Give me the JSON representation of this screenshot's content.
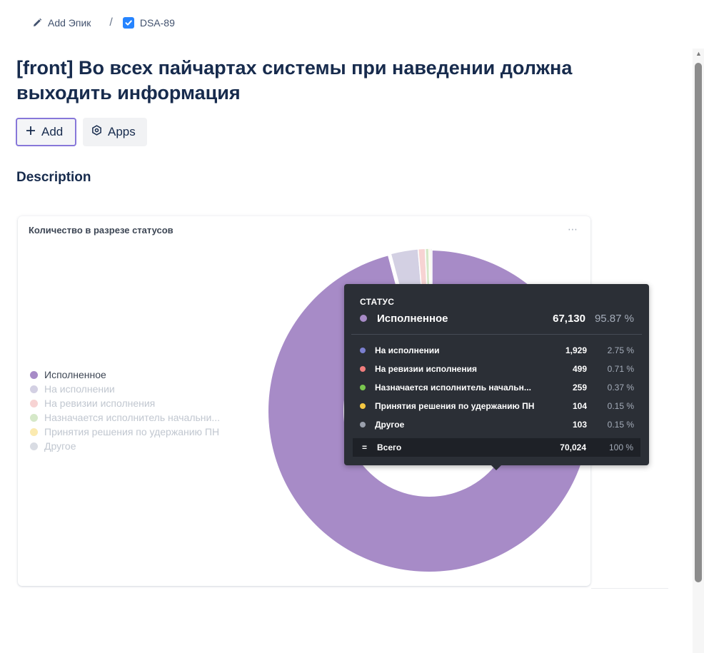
{
  "breadcrumb": {
    "parent_label": "Add Эпик",
    "separator": "/",
    "issue_key": "DSA-89"
  },
  "page_title": "[front] Во всех пайчартах системы при наведении должна выходить информация",
  "actions": {
    "add_label": "Add",
    "apps_label": "Apps"
  },
  "description_heading": "Description",
  "chart_data": {
    "type": "pie",
    "title": "Количество в разрезе статусов",
    "legend_position": "left",
    "categories": [
      "Исполненное",
      "На исполнении",
      "На ревизии исполнения",
      "Назначается исполнитель начальни...",
      "Принятия решения по удержанию ПН",
      "Другое"
    ],
    "values": [
      67130,
      1929,
      499,
      259,
      104,
      103
    ],
    "colors": [
      "#a78bc7",
      "#d3d0e3",
      "#f7d3d3",
      "#d5e8c8",
      "#fbeab0",
      "#d9dce3"
    ]
  },
  "tooltip": {
    "header": "СТАТУС",
    "main": {
      "name": "Исполненное",
      "value": "67,130",
      "pct": "95.87 %",
      "color": "#a78bc7"
    },
    "rows": [
      {
        "name": "На исполнении",
        "value": "1,929",
        "pct": "2.75 %",
        "color": "#7b7fcf"
      },
      {
        "name": "На ревизии исполнения",
        "value": "499",
        "pct": "0.71 %",
        "color": "#f07d7d"
      },
      {
        "name": "Назначается исполнитель начальн...",
        "value": "259",
        "pct": "0.37 %",
        "color": "#7ac74f"
      },
      {
        "name": "Принятия решения по удержанию ПН",
        "value": "104",
        "pct": "0.15 %",
        "color": "#f5c842"
      },
      {
        "name": "Другое",
        "value": "103",
        "pct": "0.15 %",
        "color": "#9aa0ac"
      }
    ],
    "total": {
      "symbol": "=",
      "name": "Всего",
      "value": "70,024",
      "pct": "100 %"
    }
  },
  "more_icon": "⋯"
}
